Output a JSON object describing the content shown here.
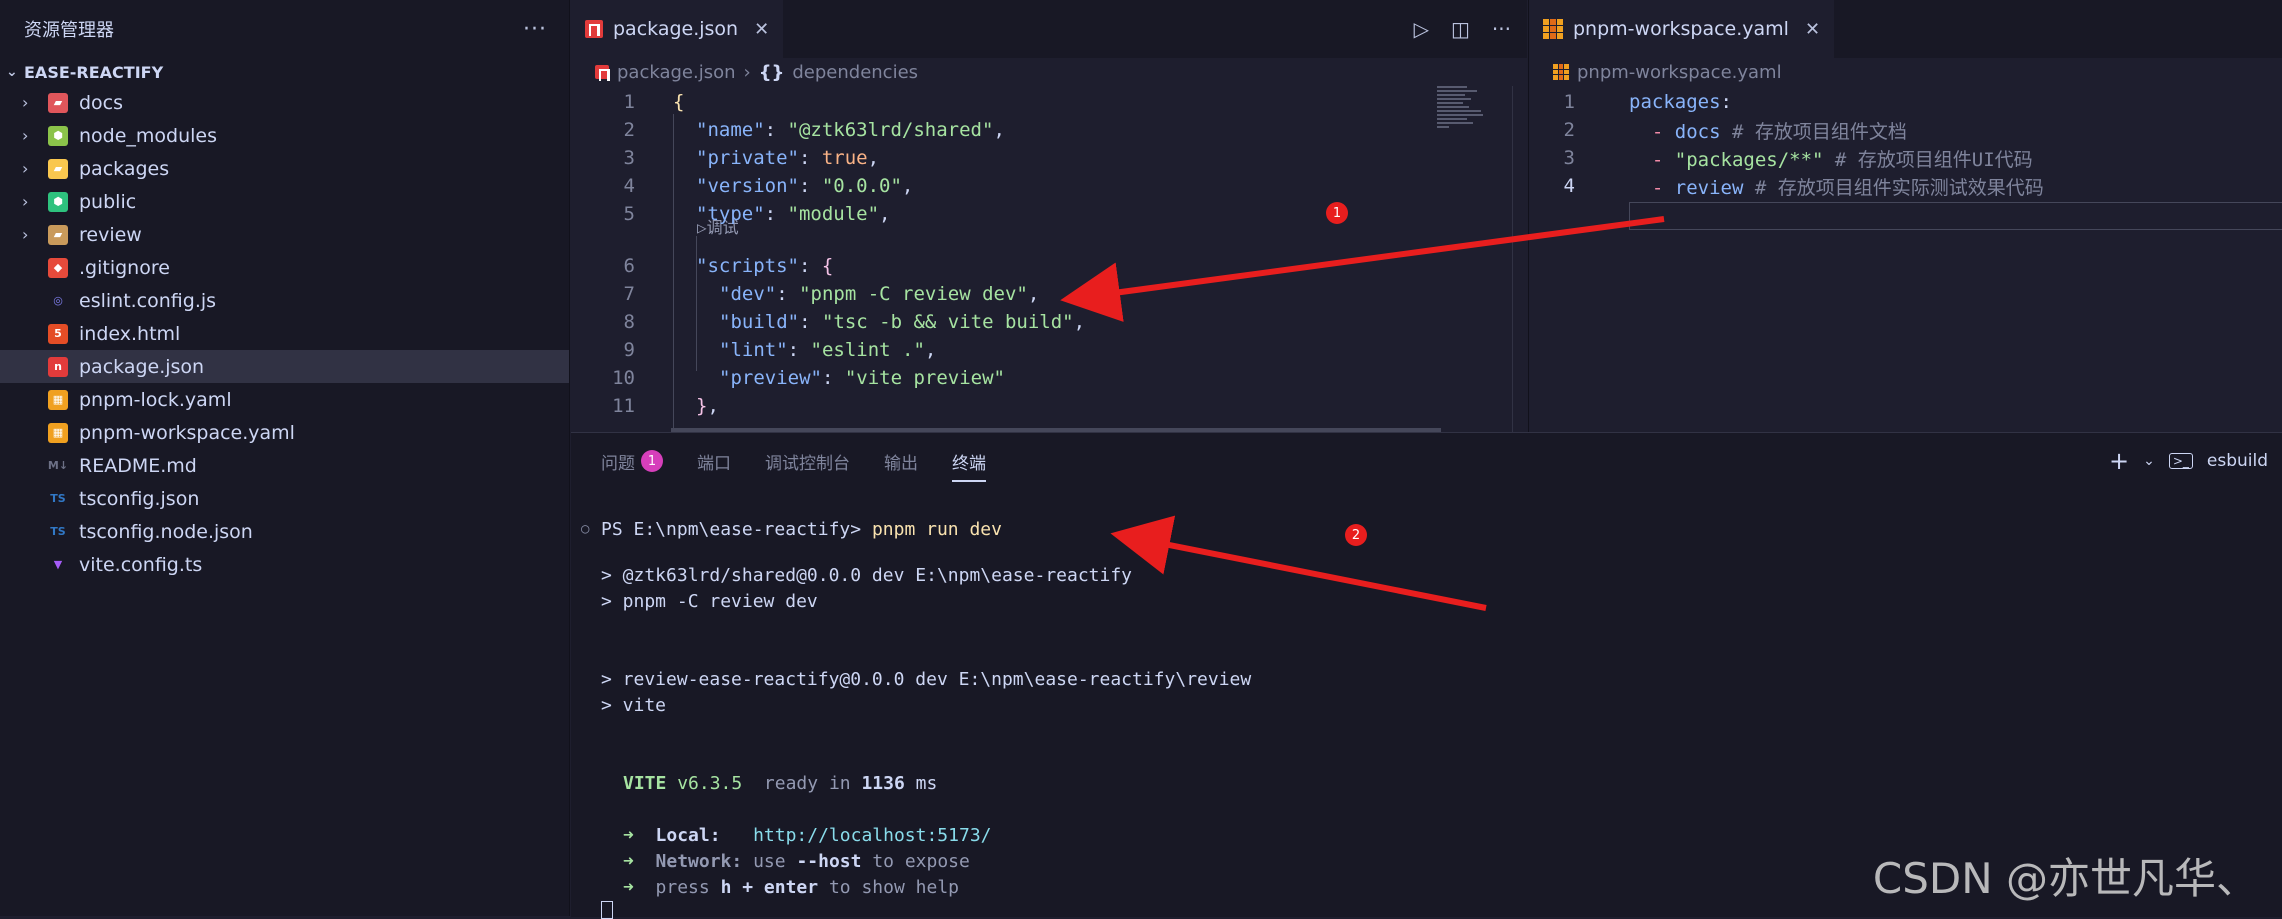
{
  "sidebar": {
    "title": "资源管理器",
    "more_label": "···",
    "project": "EASE-REACTIFY",
    "items": [
      {
        "label": "docs",
        "type": "folder",
        "icon": "folder-docs-icon",
        "color": "#e0565b"
      },
      {
        "label": "node_modules",
        "type": "folder",
        "icon": "folder-node-icon",
        "color": "#8bc34a"
      },
      {
        "label": "packages",
        "type": "folder",
        "icon": "folder-packages-icon",
        "color": "#f9c74f"
      },
      {
        "label": "public",
        "type": "folder",
        "icon": "folder-public-icon",
        "color": "#2ec27e"
      },
      {
        "label": "review",
        "type": "folder",
        "icon": "folder-icon",
        "color": "#c99a5b"
      },
      {
        "label": ".gitignore",
        "type": "file",
        "icon": "git-icon",
        "color": "#e64a3b"
      },
      {
        "label": "eslint.config.js",
        "type": "file",
        "icon": "eslint-icon",
        "color": "#8080f0"
      },
      {
        "label": "index.html",
        "type": "file",
        "icon": "html-icon",
        "color": "#e44d26"
      },
      {
        "label": "package.json",
        "type": "file",
        "icon": "npm-icon",
        "color": "#e23b3b",
        "selected": true
      },
      {
        "label": "pnpm-lock.yaml",
        "type": "file",
        "icon": "pnpm-icon",
        "color": "#f0a020"
      },
      {
        "label": "pnpm-workspace.yaml",
        "type": "file",
        "icon": "pnpm-icon",
        "color": "#f0a020"
      },
      {
        "label": "README.md",
        "type": "file",
        "icon": "markdown-icon",
        "color": "#6c7086"
      },
      {
        "label": "tsconfig.json",
        "type": "file",
        "icon": "tsconfig-icon",
        "color": "#3178c6"
      },
      {
        "label": "tsconfig.node.json",
        "type": "file",
        "icon": "tsconfig-icon",
        "color": "#3178c6"
      },
      {
        "label": "vite.config.ts",
        "type": "file",
        "icon": "vite-icon",
        "color": "#a55cf7"
      }
    ]
  },
  "editor1": {
    "tab_label": "package.json",
    "close_label": "✕",
    "breadcrumb": [
      "package.json",
      "{}",
      "dependencies"
    ],
    "codelens": "▷调试",
    "lines": [
      {
        "n": "1",
        "parts": [
          [
            "b1",
            "{"
          ]
        ]
      },
      {
        "n": "2",
        "parts": [
          [
            "k",
            "\"name\""
          ],
          [
            "p",
            ": "
          ],
          [
            "s",
            "\"@ztk63lrd/shared\""
          ],
          [
            "p",
            ","
          ]
        ]
      },
      {
        "n": "3",
        "parts": [
          [
            "k",
            "\"private\""
          ],
          [
            "p",
            ": "
          ],
          [
            "kw",
            "true"
          ],
          [
            "p",
            ","
          ]
        ]
      },
      {
        "n": "4",
        "parts": [
          [
            "k",
            "\"version\""
          ],
          [
            "p",
            ": "
          ],
          [
            "s",
            "\"0.0.0\""
          ],
          [
            "p",
            ","
          ]
        ]
      },
      {
        "n": "5",
        "parts": [
          [
            "k",
            "\"type\""
          ],
          [
            "p",
            ": "
          ],
          [
            "s",
            "\"module\""
          ],
          [
            "p",
            ","
          ]
        ]
      },
      {
        "n": "6",
        "parts": [
          [
            "k",
            "\"scripts\""
          ],
          [
            "p",
            ": "
          ],
          [
            "b2",
            "{"
          ]
        ]
      },
      {
        "n": "7",
        "parts": [
          [
            "k",
            "\"dev\""
          ],
          [
            "p",
            ": "
          ],
          [
            "s",
            "\"pnpm -C review dev\""
          ],
          [
            "p",
            ","
          ]
        ]
      },
      {
        "n": "8",
        "parts": [
          [
            "k",
            "\"build\""
          ],
          [
            "p",
            ": "
          ],
          [
            "s",
            "\"tsc -b && vite build\""
          ],
          [
            "p",
            ","
          ]
        ]
      },
      {
        "n": "9",
        "parts": [
          [
            "k",
            "\"lint\""
          ],
          [
            "p",
            ": "
          ],
          [
            "s",
            "\"eslint .\""
          ],
          [
            "p",
            ","
          ]
        ]
      },
      {
        "n": "10",
        "parts": [
          [
            "k",
            "\"preview\""
          ],
          [
            "p",
            ": "
          ],
          [
            "s",
            "\"vite preview\""
          ]
        ]
      },
      {
        "n": "11",
        "parts": [
          [
            "b2",
            "}"
          ],
          [
            "p",
            ","
          ]
        ]
      }
    ]
  },
  "editor2": {
    "tab_label": "pnpm-workspace.yaml",
    "close_label": "✕",
    "breadcrumb": "pnpm-workspace.yaml",
    "lines": [
      {
        "n": "1",
        "parts": [
          [
            "yaml-key",
            "packages"
          ],
          [
            "p",
            ":"
          ]
        ]
      },
      {
        "n": "2",
        "parts": [
          [
            "yaml-dash",
            "  - "
          ],
          [
            "yaml-key",
            "docs"
          ],
          [
            "cjk",
            " # 存放项目组件文档"
          ]
        ]
      },
      {
        "n": "3",
        "parts": [
          [
            "yaml-dash",
            "  - "
          ],
          [
            "yaml-str",
            "\"packages/**\""
          ],
          [
            "cjk",
            " # 存放项目组件UI代码"
          ]
        ]
      },
      {
        "n": "4",
        "parts": [
          [
            "yaml-dash",
            "  - "
          ],
          [
            "yaml-key",
            "review"
          ],
          [
            "cjk",
            " # 存放项目组件实际测试效果代码"
          ]
        ]
      }
    ]
  },
  "panel": {
    "tabs": [
      "问题",
      "端口",
      "调试控制台",
      "输出",
      "终端"
    ],
    "problems_count": "1",
    "active_tab": "终端",
    "terminal_name": "esbuild",
    "add_label": "+",
    "terminal": {
      "prompt": "PS E:\\npm\\ease-reactify>",
      "command": "pnpm run dev",
      "out1": "> @ztk63lrd/shared@0.0.0 dev E:\\npm\\ease-reactify",
      "out2": "> pnpm -C review dev",
      "out3": "> review-ease-reactify@0.0.0 dev E:\\npm\\ease-reactify\\review",
      "out4": "> vite",
      "vite_name": "VITE",
      "vite_version": "v6.3.5",
      "ready_text": "ready in",
      "ready_ms": "1136",
      "ms_label": "ms",
      "local_label": "Local:",
      "local_url": "http://localhost:5173/",
      "network_label": "Network:",
      "network_use": "use",
      "network_host": "--host",
      "network_expose": "to expose",
      "press_label": "press",
      "press_keys": "h + enter",
      "press_help": "to show help"
    }
  },
  "annotations": {
    "marker1": "1",
    "marker2": "2",
    "arrow_color": "#e81e1e"
  },
  "watermark": "CSDN @亦世凡华、"
}
